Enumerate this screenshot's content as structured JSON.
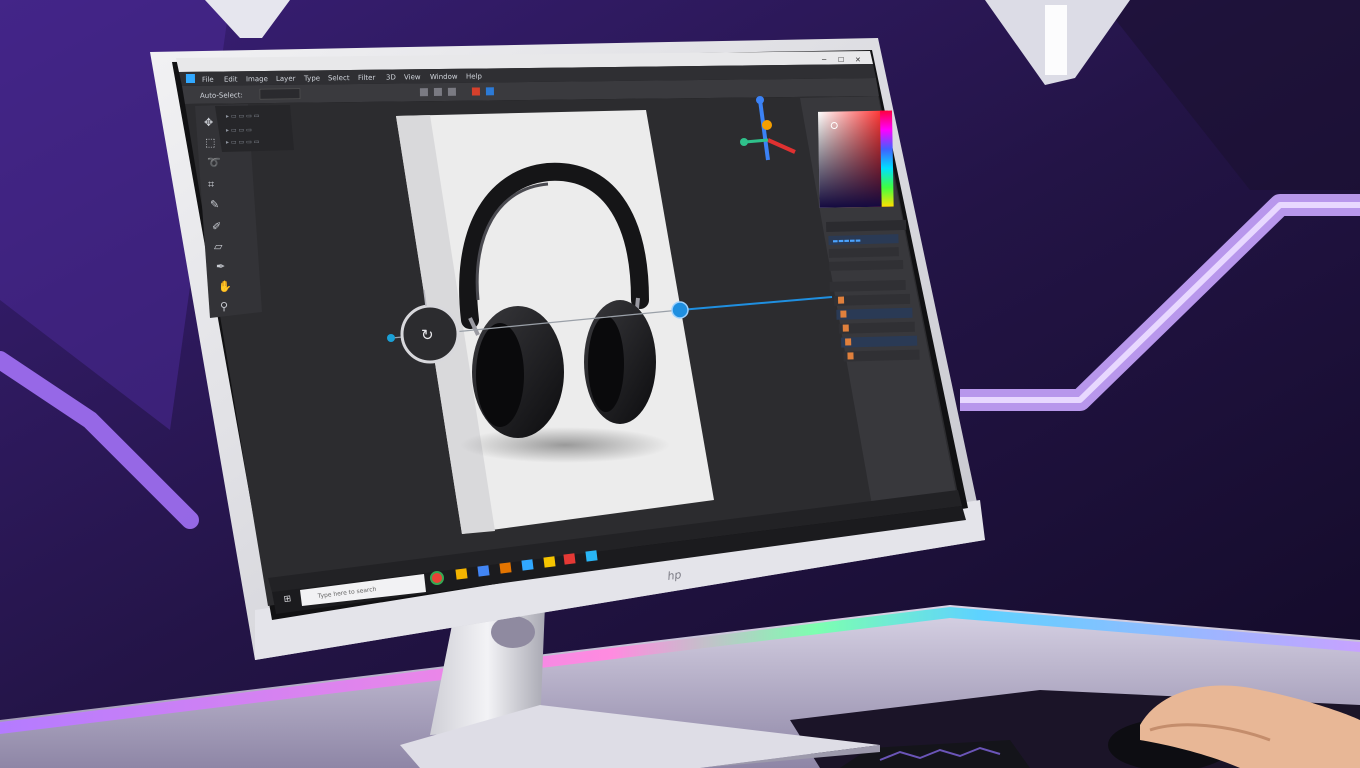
{
  "window": {
    "title": ""
  },
  "menu": {
    "items": [
      "File",
      "Edit",
      "Image",
      "Layer",
      "Type",
      "Select",
      "Filter",
      "3D",
      "View",
      "Window",
      "Help"
    ]
  },
  "tool_options": {
    "label": "Auto-Select:"
  },
  "taskbar": {
    "search_placeholder": "Type here to search"
  },
  "monitor": {
    "brand_mark": "hp"
  },
  "colors": {
    "accent_blue": "#1f8fe0",
    "wall_purple": "#6a2fc9",
    "neon_strip": "#c9a6ff",
    "app_bg": "#2b2b2b",
    "canvas_bg": "#ececec"
  },
  "icons": [
    "app-logo-icon",
    "move-tool-icon",
    "brush-icon",
    "eraser-icon",
    "lasso-icon",
    "crop-icon",
    "pen-tool-icon",
    "color-picker-icon",
    "windows-start-icon",
    "chrome-icon",
    "folder-icon",
    "mail-icon",
    "store-icon"
  ]
}
